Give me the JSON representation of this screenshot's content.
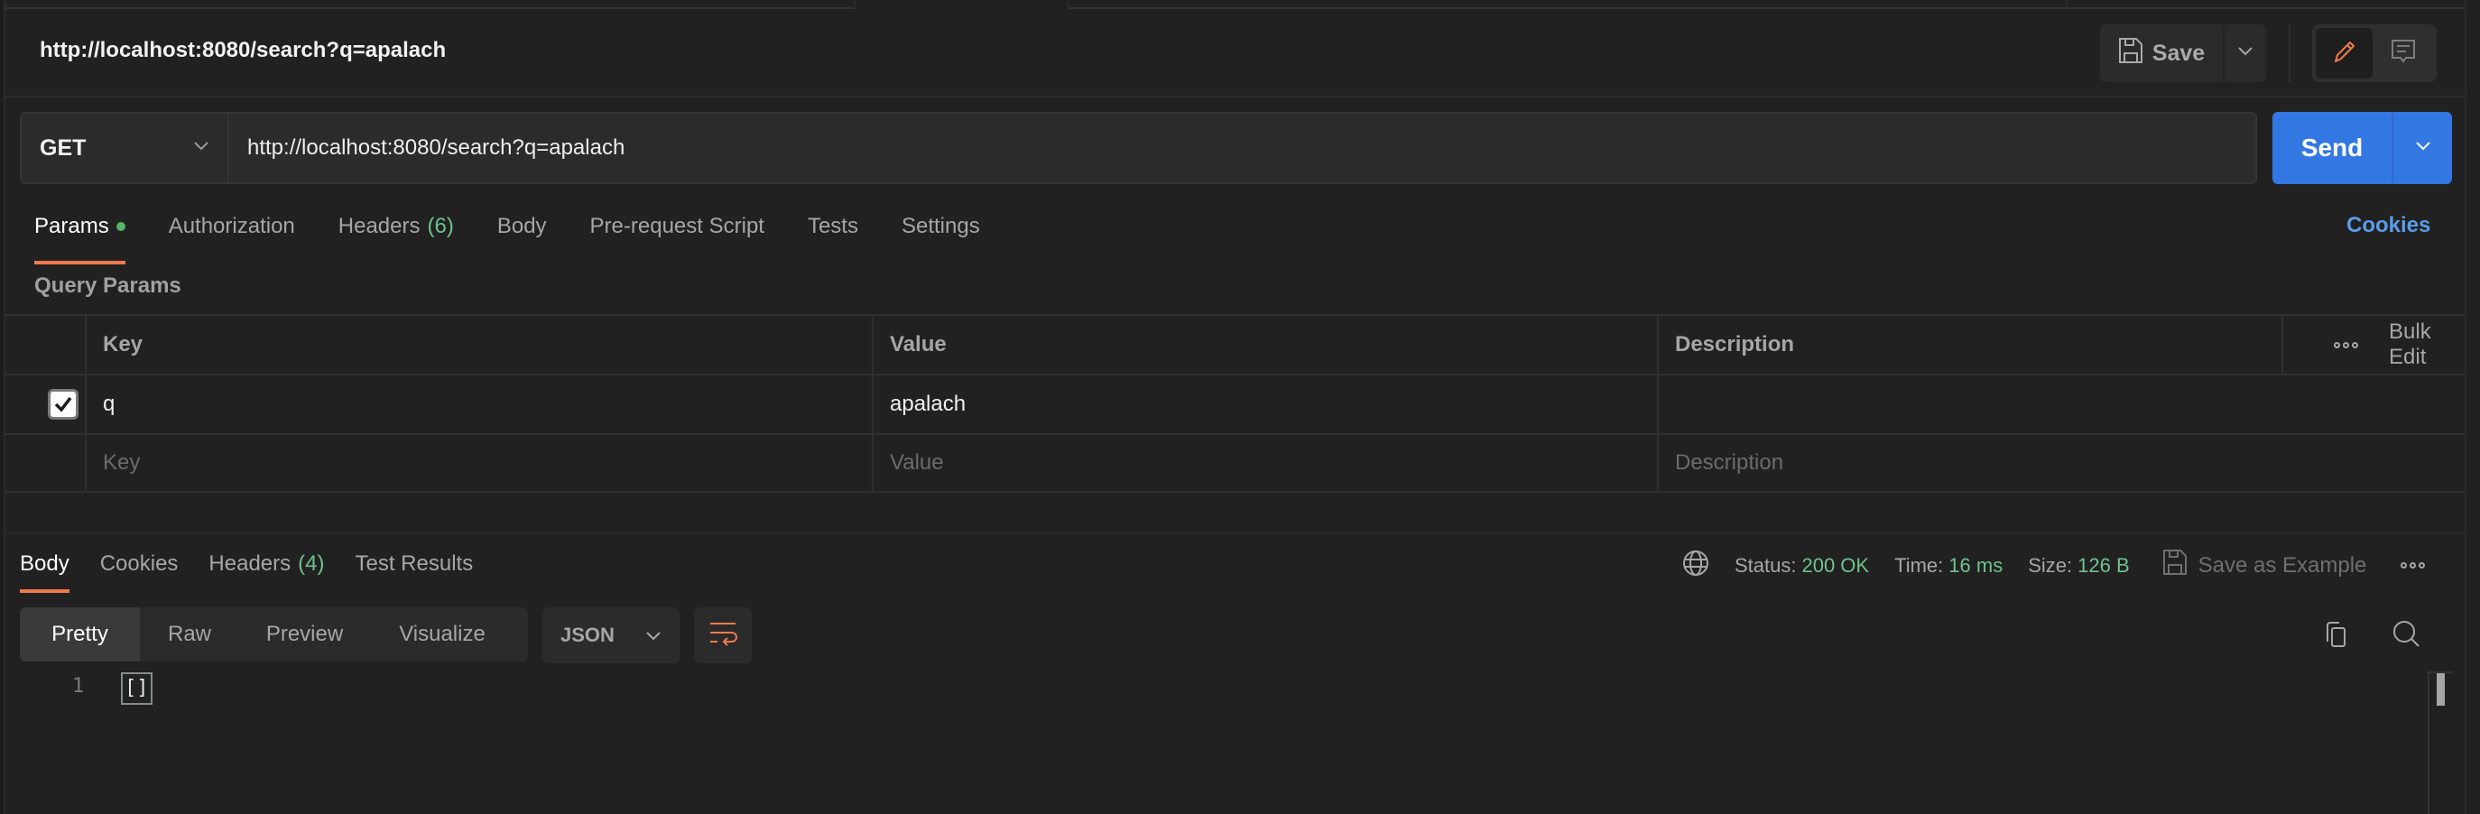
{
  "tabstrip": {
    "active_index": 1
  },
  "header": {
    "title": "http://localhost:8080/search?q=apalach",
    "save_label": "Save",
    "icons": {
      "save": "floppy-disk-icon",
      "caret": "chevron-down-icon",
      "edit": "pencil-icon",
      "comment": "comment-icon"
    },
    "accent_color": "#ef7a4d"
  },
  "request": {
    "method": "GET",
    "url": "http://localhost:8080/search?q=apalach",
    "send_label": "Send",
    "send_color": "#3378e2"
  },
  "request_tabs": [
    {
      "label": "Params",
      "active": true,
      "dot": true
    },
    {
      "label": "Authorization"
    },
    {
      "label": "Headers",
      "count": "(6)"
    },
    {
      "label": "Body"
    },
    {
      "label": "Pre-request Script"
    },
    {
      "label": "Tests"
    },
    {
      "label": "Settings"
    }
  ],
  "cookies_link": "Cookies",
  "query_params": {
    "section_label": "Query Params",
    "columns": [
      "Key",
      "Value",
      "Description"
    ],
    "bulk_edit_label": "Bulk Edit",
    "rows": [
      {
        "checked": true,
        "key": "q",
        "value": "apalach",
        "description": ""
      }
    ],
    "placeholders": {
      "key": "Key",
      "value": "Value",
      "description": "Description"
    }
  },
  "response": {
    "tabs": [
      {
        "label": "Body",
        "active": true
      },
      {
        "label": "Cookies"
      },
      {
        "label": "Headers",
        "count": "(4)"
      },
      {
        "label": "Test Results"
      }
    ],
    "status_label": "Status:",
    "status_value": "200 OK",
    "time_label": "Time:",
    "time_value": "16 ms",
    "size_label": "Size:",
    "size_value": "126 B",
    "save_example_label": "Save as Example",
    "success_color": "#6ec28c",
    "view_modes": [
      "Pretty",
      "Raw",
      "Preview",
      "Visualize"
    ],
    "active_view": "Pretty",
    "format": "JSON",
    "body_lines": [
      {
        "number": "1",
        "text": "[]"
      }
    ]
  }
}
